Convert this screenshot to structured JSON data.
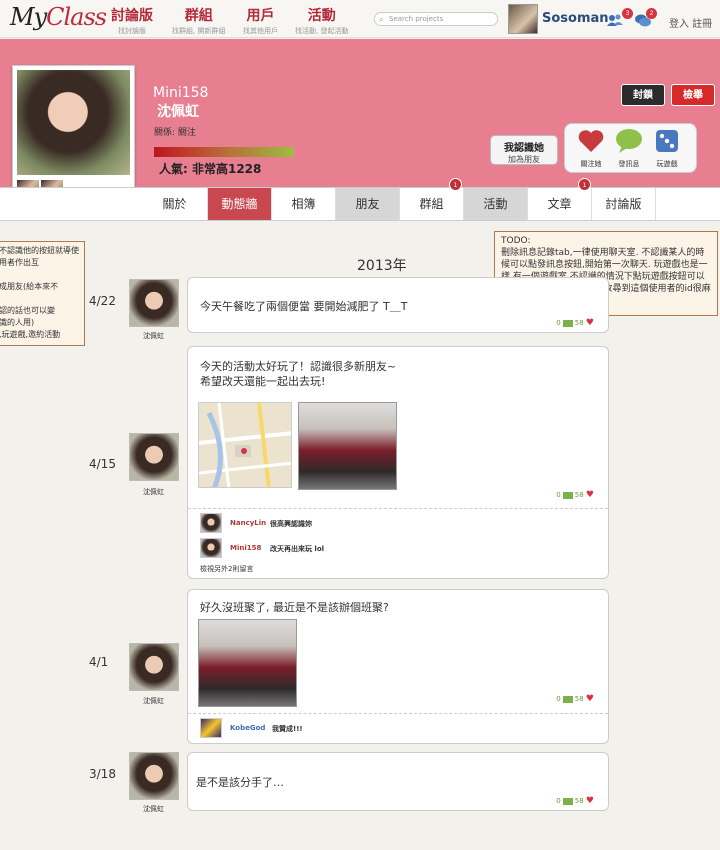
{
  "brand": {
    "my": "My",
    "class": "Class"
  },
  "nav": [
    {
      "label": "討論版",
      "sub": "找討論版"
    },
    {
      "label": "群組",
      "sub": "找群組, 開新群組"
    },
    {
      "label": "用戶",
      "sub": "找其他用戶"
    },
    {
      "label": "活動",
      "sub": "找活動, 發起活動"
    }
  ],
  "search": {
    "placeholder": "Search projects"
  },
  "user": {
    "name": "Sosoman",
    "friend_requests": "3",
    "messages": "2"
  },
  "auth": {
    "label": "登入 註冊"
  },
  "profile": {
    "name_en": "Mini158",
    "name_cn": "沈佩虹",
    "relation": "關係: 關注",
    "popularity_label": "人氣: 非常高1228",
    "popularity_level": 1.0
  },
  "buttons": {
    "block": "封鎖",
    "report": "檢舉",
    "know_main": "我認識她",
    "know_sub": "加為朋友"
  },
  "actions": [
    {
      "label": "關注她",
      "icon": "heart-icon"
    },
    {
      "label": "發訊息",
      "icon": "chat-bubble-icon"
    },
    {
      "label": "玩遊戲",
      "icon": "dice-icon"
    }
  ],
  "tabs": [
    {
      "label": "關於"
    },
    {
      "label": "動態牆"
    },
    {
      "label": "相簿"
    },
    {
      "label": "朋友"
    },
    {
      "label": "群組",
      "badge": "1"
    },
    {
      "label": "活動"
    },
    {
      "label": "文章",
      "badge": "1"
    },
    {
      "label": "討論版"
    }
  ],
  "notes": {
    "left": "不認識他的按鈕就導使用者作出互\n\n成朋友(給本來不\n\n認的話也可以變\n識的人用)\n,玩遊戲,邀約活動",
    "right_title": "TODO:",
    "right_body": "刪除訊息記錄tab,一律使用聊天室. 不認識某人的時候可以點發訊息按鈕,開始第一次聊天. 玩遊戲也是一樣,有一個遊戲室,不認識的情況下點玩遊戲按鈕可以開始第一次玩(不然的話要收尋到這個使用者的id很麻煩)"
  },
  "year": "2013年",
  "posts": [
    {
      "date": "4/22",
      "author": "沈佩虹",
      "text": "今天午餐吃了兩個便當 要開始減肥了  T＿T",
      "comments_count": "0",
      "likes": "58"
    },
    {
      "date": "4/15",
      "author": "沈佩虹",
      "text1": "今天的活動太好玩了！認識很多新朋友~",
      "text2": "希望改天還能一起出去玩!",
      "comments_count": "0",
      "likes": "58",
      "comments": [
        {
          "name": "NancyLin",
          "text": "很高興認識妳"
        },
        {
          "name": "Mini158",
          "text": "改天再出來玩 lol"
        }
      ],
      "more": "檢視另外2則留言"
    },
    {
      "date": "4/1",
      "author": "沈佩虹",
      "text": "好久沒班聚了, 最近是不是該辦個班聚?",
      "comments_count": "0",
      "likes": "58",
      "comments": [
        {
          "name": "KobeGod",
          "text": "我贊成!!!"
        }
      ]
    },
    {
      "date": "3/18",
      "author": "沈佩虹",
      "text": "是不是該分手了…",
      "comments_count": "0",
      "likes": "58"
    }
  ]
}
